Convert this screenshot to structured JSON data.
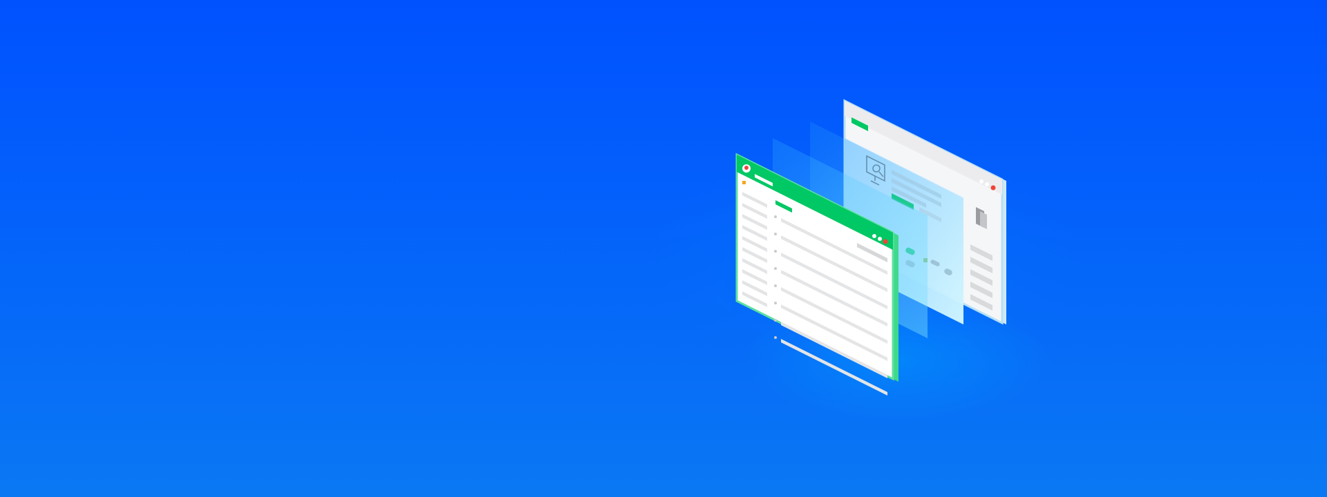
{
  "page": {
    "background_top": "#0052ff",
    "background_bottom": "#0a78f3"
  },
  "illustration": {
    "front_window": {
      "title_bar_color": "#00c864",
      "border_color": "#3fd98b",
      "close_button_color": "#f04438",
      "list_rows": 8,
      "sidebar_items": 10
    },
    "back_window": {
      "panel_color": "#f3f4f6",
      "border_color": "#9fd3ef",
      "accent_color": "#00c864",
      "close_button_color": "#f04438",
      "icon": "monitor-search-icon",
      "side_list_items": 6
    },
    "glass_layers": {
      "color": "#5ec8ff",
      "count": 2
    },
    "sound_waves": {
      "color": "#7fd4ff"
    }
  }
}
